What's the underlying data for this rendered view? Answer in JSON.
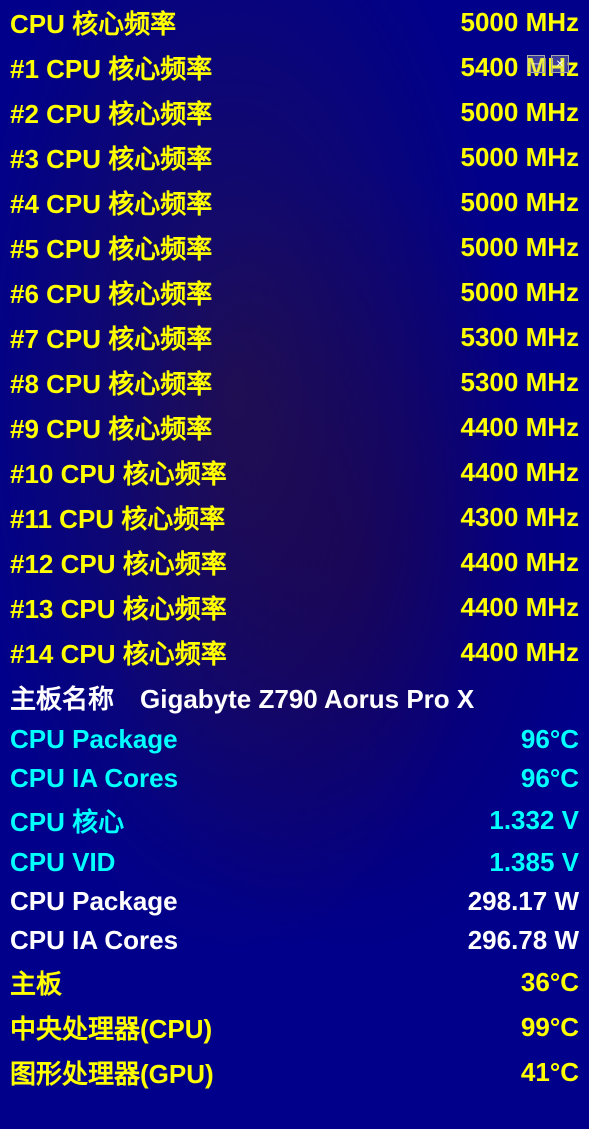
{
  "rows": [
    {
      "id": "cpu-core-freq",
      "label": "CPU 核心频率",
      "value": "5000 MHz",
      "color": "yellow"
    },
    {
      "id": "cpu-core-freq-1",
      "label": "#1 CPU 核心频率",
      "value": "5400 MHz",
      "color": "yellow"
    },
    {
      "id": "cpu-core-freq-2",
      "label": "#2 CPU 核心频率",
      "value": "5000 MHz",
      "color": "yellow"
    },
    {
      "id": "cpu-core-freq-3",
      "label": "#3 CPU 核心频率",
      "value": "5000 MHz",
      "color": "yellow"
    },
    {
      "id": "cpu-core-freq-4",
      "label": "#4 CPU 核心频率",
      "value": "5000 MHz",
      "color": "yellow"
    },
    {
      "id": "cpu-core-freq-5",
      "label": "#5 CPU 核心频率",
      "value": "5000 MHz",
      "color": "yellow"
    },
    {
      "id": "cpu-core-freq-6",
      "label": "#6 CPU 核心频率",
      "value": "5000 MHz",
      "color": "yellow"
    },
    {
      "id": "cpu-core-freq-7",
      "label": "#7 CPU 核心频率",
      "value": "5300 MHz",
      "color": "yellow"
    },
    {
      "id": "cpu-core-freq-8",
      "label": "#8 CPU 核心频率",
      "value": "5300 MHz",
      "color": "yellow"
    },
    {
      "id": "cpu-core-freq-9",
      "label": "#9 CPU 核心频率",
      "value": "4400 MHz",
      "color": "yellow"
    },
    {
      "id": "cpu-core-freq-10",
      "label": "#10 CPU 核心频率",
      "value": "4400 MHz",
      "color": "yellow"
    },
    {
      "id": "cpu-core-freq-11",
      "label": "#11 CPU 核心频率",
      "value": "4300 MHz",
      "color": "yellow"
    },
    {
      "id": "cpu-core-freq-12",
      "label": "#12 CPU 核心频率",
      "value": "4400 MHz",
      "color": "yellow"
    },
    {
      "id": "cpu-core-freq-13",
      "label": "#13 CPU 核心频率",
      "value": "4400 MHz",
      "color": "yellow"
    },
    {
      "id": "cpu-core-freq-14",
      "label": "#14 CPU 核心频率",
      "value": "4400 MHz",
      "color": "yellow"
    },
    {
      "id": "motherboard-name",
      "label": "主板名称　Gigabyte Z790 Aorus Pro X",
      "value": "",
      "color": "white"
    },
    {
      "id": "cpu-package-temp",
      "label": "CPU Package",
      "value": "96°C",
      "color": "cyan"
    },
    {
      "id": "cpu-ia-cores-temp",
      "label": "CPU IA Cores",
      "value": "96°C",
      "color": "cyan"
    },
    {
      "id": "cpu-core-volt",
      "label": "CPU 核心",
      "value": "1.332 V",
      "color": "cyan"
    },
    {
      "id": "cpu-vid",
      "label": "CPU VID",
      "value": "1.385 V",
      "color": "cyan"
    },
    {
      "id": "cpu-package-power",
      "label": "CPU Package",
      "value": "298.17 W",
      "color": "white"
    },
    {
      "id": "cpu-ia-cores-power",
      "label": "CPU IA Cores",
      "value": "296.78 W",
      "color": "white"
    },
    {
      "id": "motherboard-temp",
      "label": "主板",
      "value": "36°C",
      "color": "yellow"
    },
    {
      "id": "cpu-temp",
      "label": "中央处理器(CPU)",
      "value": "99°C",
      "color": "yellow"
    },
    {
      "id": "gpu-temp",
      "label": "图形处理器(GPU)",
      "value": "41°C",
      "color": "yellow"
    }
  ],
  "window_buttons": {
    "minimize": "─",
    "close": "✕"
  }
}
